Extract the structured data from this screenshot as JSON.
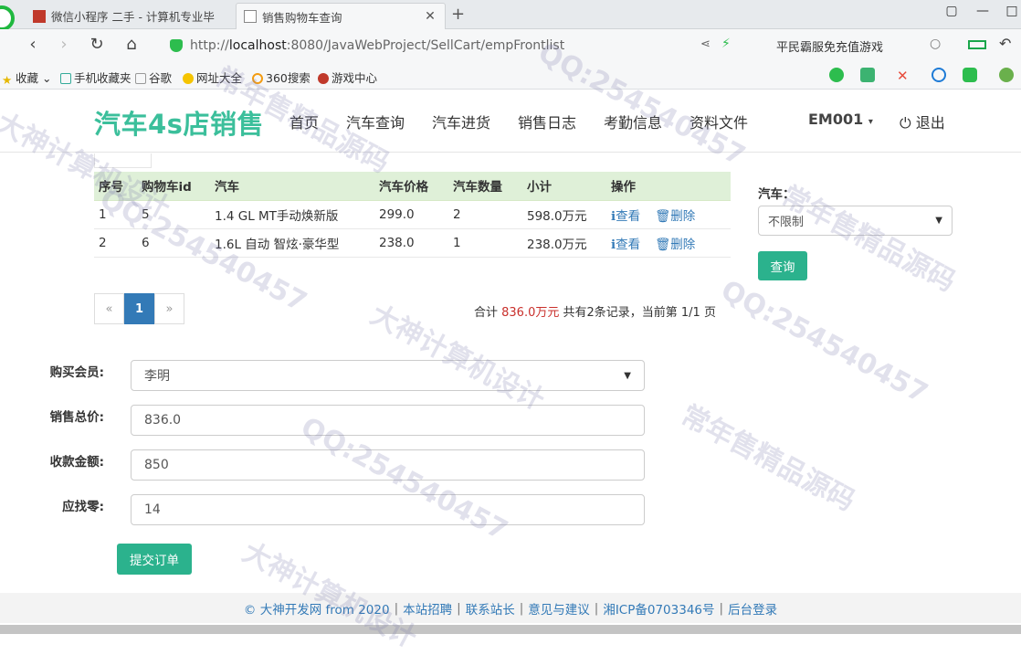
{
  "browser": {
    "tabs": [
      {
        "title": "微信小程序 二手 - 计算机专业毕",
        "active": false
      },
      {
        "title": "销售购物车查询",
        "active": true
      }
    ],
    "url_prefix": "http://",
    "url_host": "localhost",
    "url_rest": ":8080/JavaWebProject/SellCart/empFrontlist",
    "search_hint": "平民霸服免充值游戏",
    "bookmarks": [
      "收藏",
      "手机收藏夹",
      "谷歌",
      "网址大全",
      "360搜索",
      "游戏中心"
    ]
  },
  "site": {
    "brand": "汽车4s店销售",
    "nav": [
      "首页",
      "汽车查询",
      "汽车进货",
      "销售日志",
      "考勤信息",
      "资料文件"
    ],
    "user": "EM001",
    "logout": "退出"
  },
  "table": {
    "headers": [
      "序号",
      "购物车id",
      "汽车",
      "汽车价格",
      "汽车数量",
      "小计",
      "操作"
    ],
    "rows": [
      [
        "1",
        "5",
        "1.4 GL MT手动焕新版",
        "299.0",
        "2",
        "598.0万元"
      ],
      [
        "2",
        "6",
        "1.6L 自动 智炫·豪华型",
        "238.0",
        "1",
        "238.0万元"
      ]
    ],
    "op_view": "查看",
    "op_delete": "删除"
  },
  "pager": {
    "prev": "«",
    "current": "1",
    "next": "»"
  },
  "summary": {
    "prefix": "合计 ",
    "total": "836.0万元",
    "suffix": "  共有2条记录，当前第 1/1 页"
  },
  "filter": {
    "label": "汽车：",
    "value": "不限制",
    "button": "查询"
  },
  "form": {
    "member_label": "购买会员:",
    "member_value": "李明",
    "total_label": "销售总价:",
    "total_value": "836.0",
    "paid_label": "收款金额:",
    "paid_value": "850",
    "change_label": "应找零:",
    "change_value": "14",
    "submit": "提交订单"
  },
  "footer": {
    "links": [
      "© 大神开发网 from 2020",
      "本站招聘",
      "联系站长",
      "意见与建议",
      "湘ICP备0703346号",
      "后台登录"
    ]
  },
  "watermarks": [
    "QQ:254540457",
    "常年售精品源码",
    "大神计算机设计",
    "QQ:254540457",
    "常年售精品源码",
    "大神计算机设计",
    "QQ:254540457",
    "常年售精品源码",
    "QQ:254540457",
    "大神计算机设计"
  ],
  "colors": {
    "brand": "#3bbf9b",
    "primary": "#337ab7",
    "button": "#2bb28d",
    "table_head": "#dff0d8",
    "total": "#c9302c"
  }
}
